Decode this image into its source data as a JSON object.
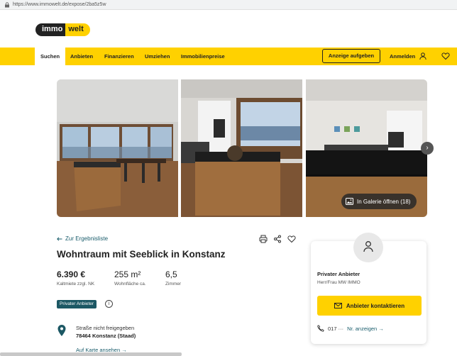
{
  "browser": {
    "url": "https://www.immowelt.de/expose/2ba5z5w"
  },
  "logo": {
    "part1": "immo",
    "part2": "welt"
  },
  "nav": {
    "items": [
      "Suchen",
      "Anbieten",
      "Finanzieren",
      "Umziehen",
      "Immobilienpreise"
    ],
    "cta": "Anzeige aufgeben",
    "login": "Anmelden"
  },
  "gallery": {
    "open_label": "In Galerie öffnen (18)"
  },
  "listing": {
    "back": "Zur Ergebnisliste",
    "title": "Wohntraum mit Seeblick in Konstanz",
    "price": "6.390 €",
    "price_label": "Kaltmiete zzgl. NK",
    "area": "255 m²",
    "area_label": "Wohnfläche ca.",
    "rooms": "6,5",
    "rooms_label": "Zimmer",
    "badge": "Privater Anbieter",
    "info_icon_glyph": "i",
    "street": "Straße nicht freigegeben",
    "city": "78464 Konstanz (Staad)",
    "map_link": "Auf Karte ansehen →"
  },
  "contact": {
    "name": "Privater Anbieter",
    "sub": "Herr/Frau MW IMMO",
    "button": "Anbieter kontaktieren",
    "phone_prefix": "017 ···",
    "phone_link": "Nr. anzeigen →"
  },
  "colors": {
    "brand_yellow": "#ffd100",
    "badge_teal": "#1c5864",
    "link": "#1a5d6c"
  }
}
